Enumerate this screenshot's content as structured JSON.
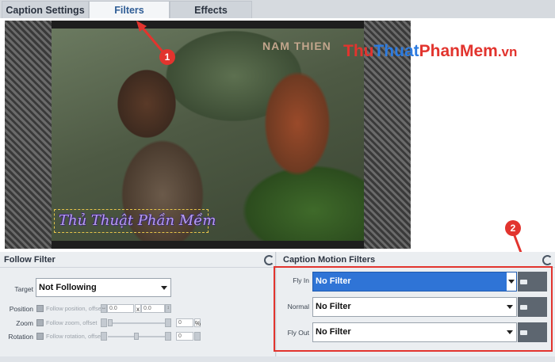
{
  "tabs": [
    {
      "label": "Caption Settings",
      "active": false
    },
    {
      "label": "Filters",
      "active": true
    },
    {
      "label": "Effects",
      "active": false
    }
  ],
  "preview": {
    "sign_text": "NAM THIEN",
    "caption_text": "Thủ Thuật Phần Mềm"
  },
  "watermark": {
    "part1": "Thu",
    "part2": "Thuat",
    "part3": "PhanMem",
    "part4": ".vn"
  },
  "badges": [
    "1",
    "2"
  ],
  "follow_filter": {
    "title": "Follow Filter",
    "target_label": "Target",
    "target_value": "Not Following",
    "position_label": "Position",
    "position_text": "Follow position, offset",
    "position_x": "0.0",
    "position_x_sep": "x",
    "position_y": "0.0",
    "zoom_label": "Zoom",
    "zoom_text": "Follow zoom, offset",
    "zoom_value": "0",
    "zoom_unit": "%",
    "rotation_label": "Rotation",
    "rotation_text": "Follow rotation, offset",
    "rotation_value": "0"
  },
  "motion_filters": {
    "title": "Caption Motion Filters",
    "rows": [
      {
        "label": "Fly In",
        "value": "No Filter",
        "browse": "browse",
        "highlight": true
      },
      {
        "label": "Normal",
        "value": "No Filter",
        "browse": "browse",
        "highlight": false
      },
      {
        "label": "Fly Out",
        "value": "No Filter",
        "browse": "browse",
        "highlight": false
      }
    ]
  },
  "colors": {
    "accent_blue": "#2f74d6",
    "annotation_red": "#e2342e",
    "tab_active_text": "#2f5d95"
  }
}
